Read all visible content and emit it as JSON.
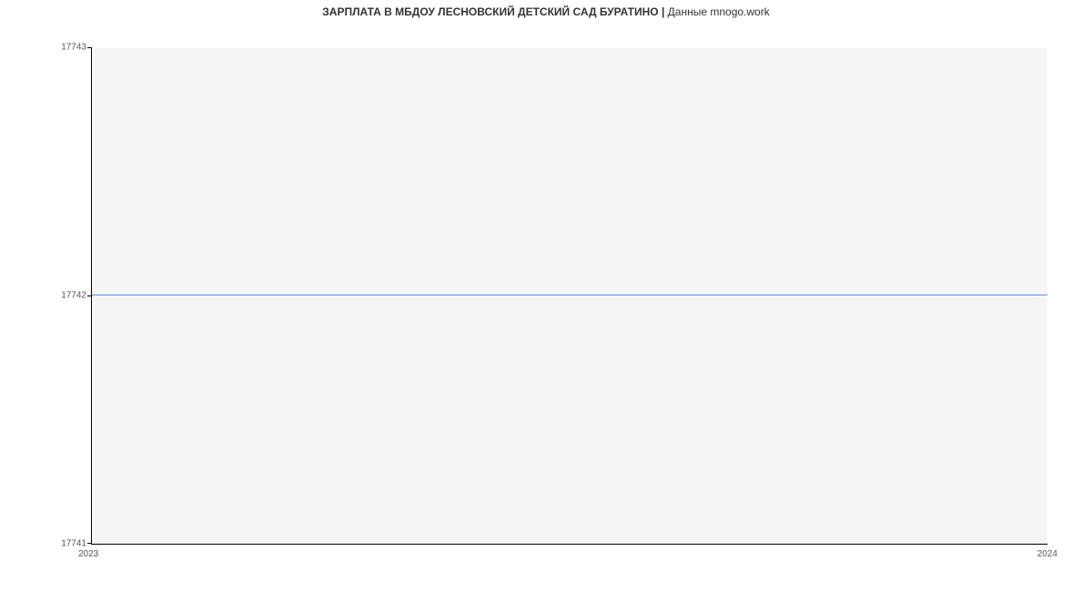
{
  "chart_data": {
    "type": "line",
    "title_main": "ЗАРПЛАТА В МБДОУ ЛЕСНОВСКИЙ ДЕТСКИЙ САД БУРАТИНО",
    "title_sep": " | ",
    "title_source_prefix": "Данные ",
    "title_source": "mnogo.work",
    "x": [
      2023,
      2024
    ],
    "values": [
      17742,
      17742
    ],
    "xlabel": "",
    "ylabel": "",
    "xticks": [
      "2023",
      "2024"
    ],
    "yticks": [
      "17741",
      "17742",
      "17743"
    ],
    "xlim": [
      2023,
      2024
    ],
    "ylim": [
      17741,
      17743
    ],
    "grid": true
  }
}
